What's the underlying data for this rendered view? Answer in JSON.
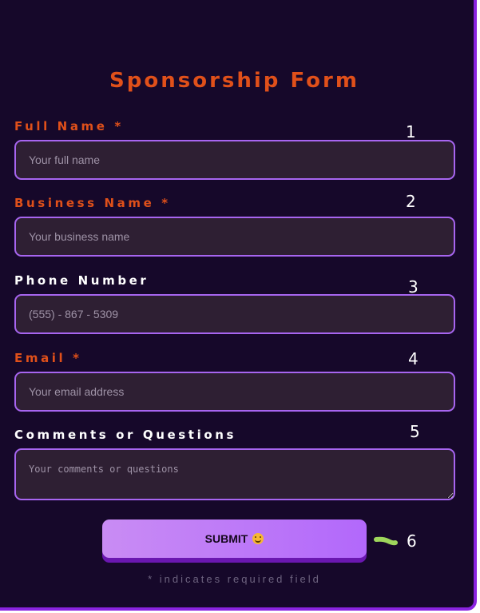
{
  "form": {
    "title": "Sponsorship Form",
    "fields": [
      {
        "label": "Full Name *",
        "placeholder": "Your full name",
        "value": "",
        "required": true,
        "marker": "1"
      },
      {
        "label": "Business Name *",
        "placeholder": "Your business name",
        "value": "",
        "required": true,
        "marker": "2"
      },
      {
        "label": "Phone Number",
        "placeholder": "(555) - 867 - 5309",
        "value": "",
        "required": false,
        "marker": "3"
      },
      {
        "label": "Email *",
        "placeholder": "Your email address",
        "value": "",
        "required": true,
        "marker": "4"
      },
      {
        "label": "Comments or Questions",
        "placeholder": "Your comments or questions",
        "value": "",
        "required": false,
        "marker": "5"
      }
    ],
    "submit": {
      "label": "SUBMIT",
      "icon": "smiley-face-icon",
      "marker": "6"
    },
    "required_note": "* indicates required field"
  },
  "colors": {
    "background": "#16082a",
    "accent_required": "#e0501a",
    "field_border": "#a765f0",
    "field_fill": "#2e1f33",
    "frame_border": "#8a24e0",
    "button_gradient_start": "#c98cf4",
    "button_gradient_end": "#b268fb",
    "squiggle": "#9ed65c"
  }
}
